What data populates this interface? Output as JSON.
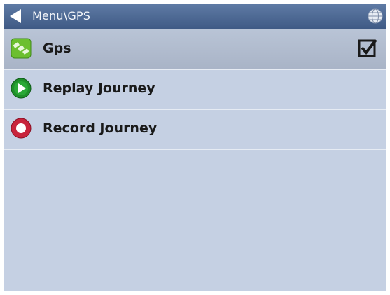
{
  "header": {
    "title": "Menu\\GPS",
    "back_icon": "back-arrow-icon",
    "globe_icon": "globe-icon"
  },
  "menu": {
    "items": [
      {
        "label": "Gps",
        "icon": "gps-satellite-icon",
        "checked": true
      },
      {
        "label": "Replay Journey",
        "icon": "play-icon"
      },
      {
        "label": "Record Journey",
        "icon": "record-icon"
      }
    ]
  },
  "colors": {
    "background": "#c5d0e3",
    "titlebar": "#4a6690",
    "gps_icon": "#6cbf2f",
    "play_icon": "#1f8f2a",
    "record_icon": "#c8243c"
  }
}
